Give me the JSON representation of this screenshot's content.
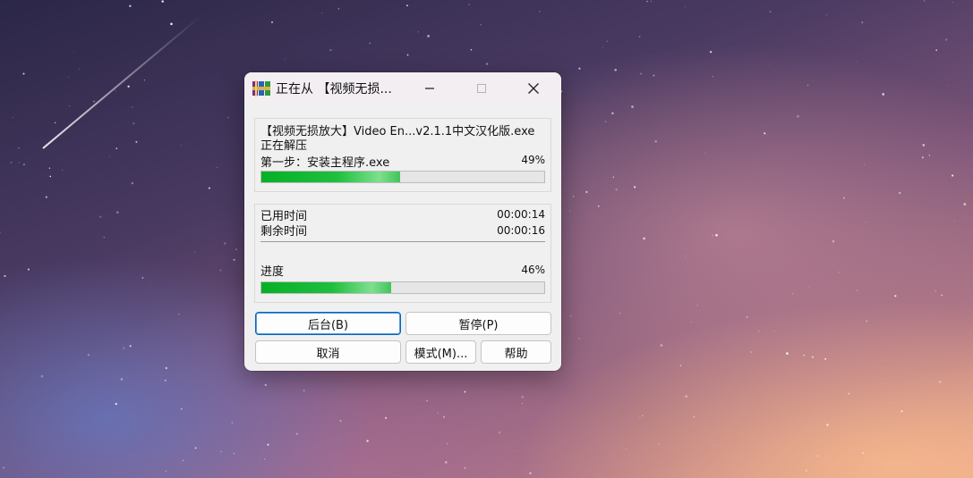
{
  "window": {
    "title": "正在从 【视频无损...",
    "controls": {
      "minimize": "–",
      "maximize": "□",
      "close": "✕"
    },
    "app_icon": "winrar-books-icon"
  },
  "archive": {
    "file_name": "【视频无损放大】Video En...v2.1.1中文汉化版.exe",
    "status": "正在解压",
    "step_label": "第一步：安装主程序.exe",
    "step_percent_text": "49%",
    "step_progress": 0.49
  },
  "timing": {
    "elapsed_label": "已用时间",
    "elapsed_value": "00:00:14",
    "remaining_label": "剩余时间",
    "remaining_value": "00:00:16",
    "progress_label": "进度",
    "progress_percent_text": "46%",
    "progress": 0.46
  },
  "buttons": {
    "background": "后台(B)",
    "pause": "暂停(P)",
    "cancel": "取消",
    "mode": "模式(M)...",
    "help": "帮助"
  },
  "colors": {
    "progress_green": "#06b025",
    "default_button_border": "#0a64b4"
  }
}
